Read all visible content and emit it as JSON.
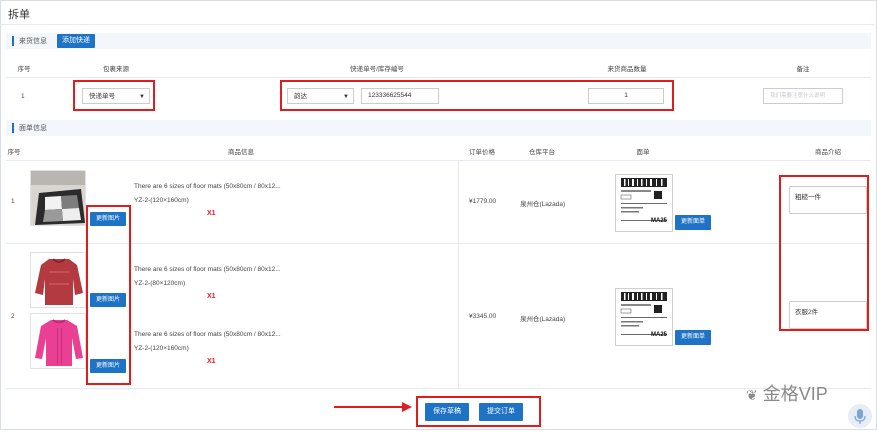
{
  "page": {
    "title": "拆单"
  },
  "source_section": {
    "title": "来货信息",
    "add_button": "添加快递",
    "headers": [
      "序号",
      "包裹来源",
      "快递单号/库存编号",
      "来货商品数量",
      "备注"
    ],
    "row": {
      "index": "1",
      "package_source": "快递单号",
      "courier": "韵达",
      "tracking_number": "123336625544",
      "quantity": "1",
      "remark_placeholder": "我们需要注意什么说明"
    }
  },
  "order_section": {
    "title": "面单信息",
    "headers": [
      "序号",
      "商品信息",
      "订单价格",
      "仓库平台",
      "面单",
      "商品介绍"
    ],
    "update_image_label": "更新图片",
    "update_label_button": "更新面单",
    "rows": [
      {
        "index": "1",
        "products": [
          {
            "name": "There are 6 sizes of floor mats (50x80cm / 80x12...",
            "sku": "YZ-2-(120×160cm)",
            "qty": "X1",
            "image": "floor-mat-image"
          }
        ],
        "price": "¥1779.00",
        "warehouse": "泉州仓(Lazada)",
        "intro": "粗糙一件"
      },
      {
        "index": "2",
        "products": [
          {
            "name": "There are 6 sizes of floor mats (50x80cm / 80x12...",
            "sku": "YZ-2-(80×120cm)",
            "qty": "X1",
            "image": "red-sweater-image"
          },
          {
            "name": "There are 6 sizes of floor mats (50x80cm / 80x12...",
            "sku": "YZ-2-(120×160cm)",
            "qty": "X1",
            "image": "pink-sweater-image"
          }
        ],
        "price": "¥3345.00",
        "warehouse": "泉州仓(Lazada)",
        "intro": "衣服2件"
      }
    ],
    "shipping_label": {
      "code": "MA25"
    }
  },
  "footer": {
    "save_draft": "保存草稿",
    "submit_order": "提交订单"
  },
  "watermark": "金格VIP",
  "colors": {
    "accent": "#1f73c7",
    "highlight": "#e11c1c"
  }
}
